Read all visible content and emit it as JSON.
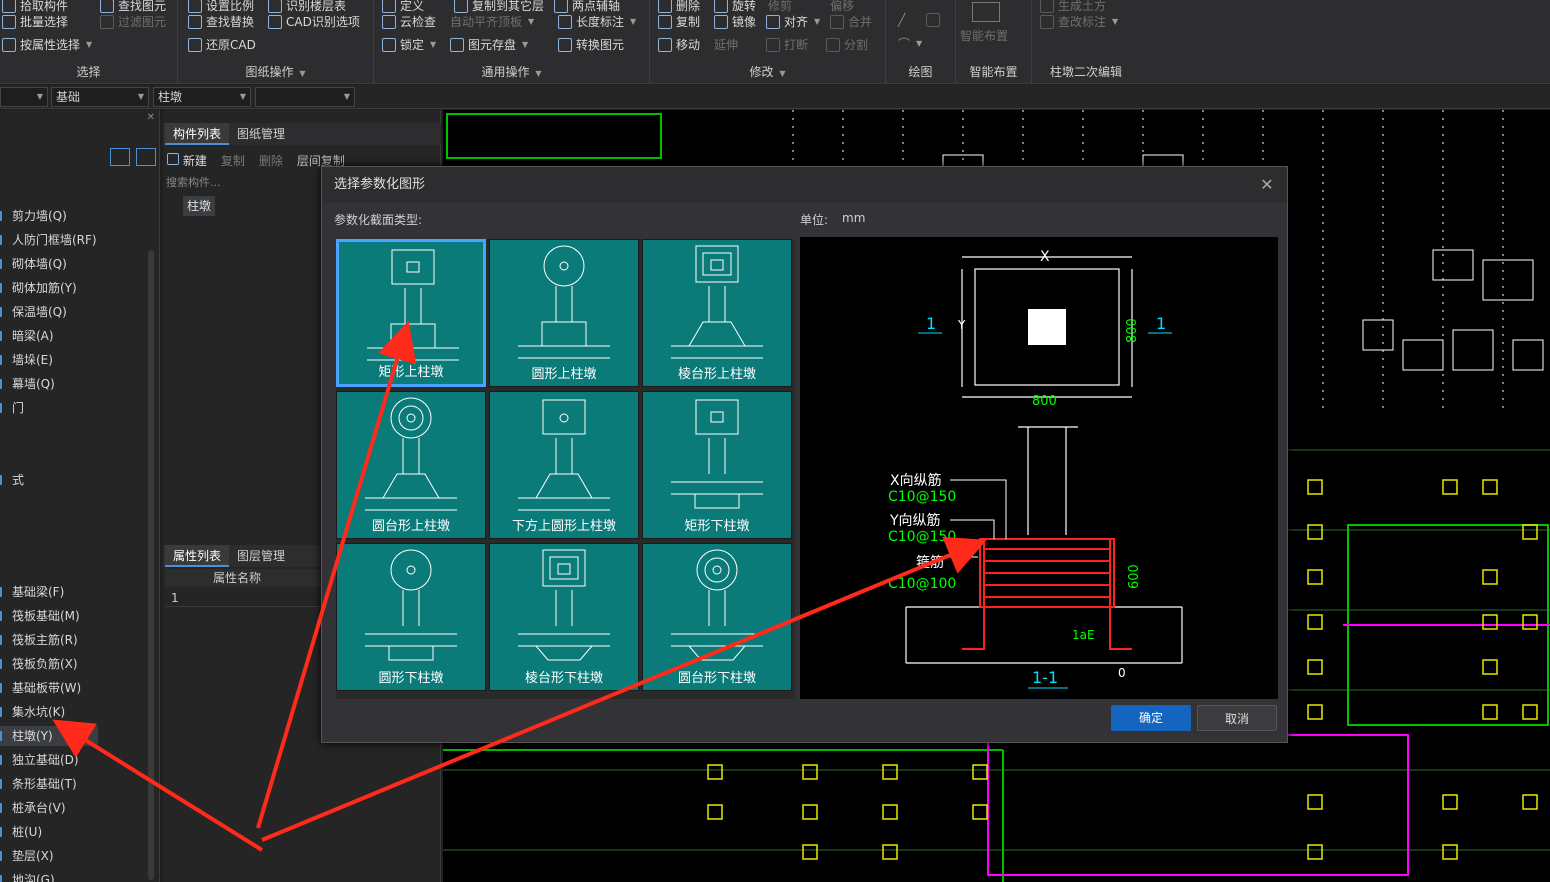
{
  "ribbon": {
    "select_group": {
      "title": "选择",
      "buttons": [
        "拾取构件",
        "批量选择",
        "按属性选择"
      ]
    },
    "filter": {
      "label": "查找图元",
      "filter_label": "过滤图元"
    },
    "drawing_ops": {
      "title": "图纸操作",
      "buttons": [
        "设置比例",
        "识别楼层表",
        "查找替换",
        "CAD识别选项",
        "还原CAD"
      ]
    },
    "general_ops": {
      "title": "通用操作",
      "buttons": [
        "定义",
        "复制到其它层",
        "云检查",
        "自动平齐顶板",
        "锁定",
        "图元存盘",
        "两点辅轴",
        "长度标注",
        "转换图元"
      ]
    },
    "modify": {
      "title": "修改",
      "buttons": [
        "删除",
        "旋转",
        "修剪",
        "偏移",
        "复制",
        "镜像",
        "对齐",
        "合并",
        "移动",
        "延伸",
        "打断",
        "分割"
      ]
    },
    "draw": {
      "title": "绘图"
    },
    "smart_layout": {
      "title": "智能布置",
      "button": "智能布置"
    },
    "pier_edit": {
      "title": "柱墩二次编辑",
      "buttons": [
        "生成土方",
        "查改标注"
      ]
    }
  },
  "toolbar2": {
    "combo1": "",
    "combo2": "基础",
    "combo3": "柱墩",
    "combo4": ""
  },
  "left_tree": {
    "items_top": [
      "剪力墙(Q)",
      "人防门框墙(RF)",
      "砌体墙(Q)",
      "砌体加筋(Y)",
      "保温墙(Q)",
      "暗梁(A)",
      "墙垛(E)",
      "幕墙(Q)",
      "门",
      "式"
    ],
    "items_bottom": [
      "基础梁(F)",
      "筏板基础(M)",
      "筏板主筋(R)",
      "筏板负筋(X)",
      "基础板带(W)",
      "集水坑(K)",
      "柱墩(Y)",
      "独立基础(D)",
      "条形基础(T)",
      "桩承台(V)",
      "桩(U)",
      "垫层(X)",
      "地沟(G)"
    ],
    "selected": "柱墩(Y)"
  },
  "mid_panel": {
    "tabs_top": [
      "构件列表",
      "图纸管理"
    ],
    "toolbar": [
      "新建",
      "复制",
      "删除",
      "层间复制"
    ],
    "search_placeholder": "搜索构件...",
    "component": "柱墩",
    "tabs_bottom": [
      "属性列表",
      "图层管理"
    ],
    "prop_header": "属性名称",
    "row1": "1"
  },
  "dialog": {
    "title": "选择参数化图形",
    "section_label": "参数化截面类型:",
    "unit_label": "单位:",
    "unit_value": "mm",
    "shapes": [
      "矩形上柱墩",
      "圆形上柱墩",
      "棱台形上柱墩",
      "圆台形上柱墩",
      "下方上圆形上柱墩",
      "矩形下柱墩",
      "圆形下柱墩",
      "棱台形下柱墩",
      "圆台形下柱墩"
    ],
    "selected_shape": "矩形上柱墩",
    "preview": {
      "dim_x": "X",
      "dim_y": "Y",
      "dim_800_h": "800",
      "dim_800_v": "800",
      "section_mark": "1",
      "x_rebar_label": "X向纵筋",
      "x_rebar_value": "C10@150",
      "y_rebar_label": "Y向纵筋",
      "y_rebar_value": "C10@150",
      "stirrup_label": "箍筋",
      "stirrup_value": "C10@100",
      "dim_600": "600",
      "la_e": "1aE",
      "zero": "0",
      "section_title": "1-1"
    },
    "ok": "确定",
    "cancel": "取消"
  }
}
